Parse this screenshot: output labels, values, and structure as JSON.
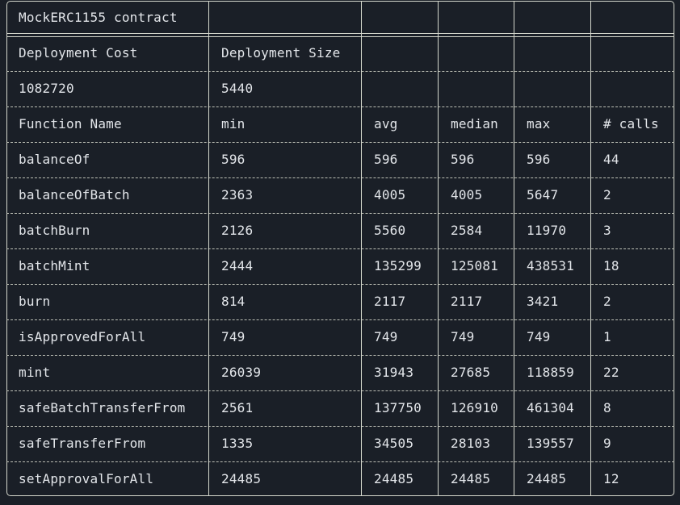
{
  "title": "MockERC1155 contract",
  "deployment": {
    "headers": [
      "Deployment Cost",
      "Deployment Size"
    ],
    "values": [
      "1082720",
      "5440"
    ]
  },
  "columns": [
    "Function Name",
    "min",
    "avg",
    "median",
    "max",
    "# calls"
  ],
  "rows": [
    [
      "balanceOf",
      "596",
      "596",
      "596",
      "596",
      "44"
    ],
    [
      "balanceOfBatch",
      "2363",
      "4005",
      "4005",
      "5647",
      "2"
    ],
    [
      "batchBurn",
      "2126",
      "5560",
      "2584",
      "11970",
      "3"
    ],
    [
      "batchMint",
      "2444",
      "135299",
      "125081",
      "438531",
      "18"
    ],
    [
      "burn",
      "814",
      "2117",
      "2117",
      "3421",
      "2"
    ],
    [
      "isApprovedForAll",
      "749",
      "749",
      "749",
      "749",
      "1"
    ],
    [
      "mint",
      "26039",
      "31943",
      "27685",
      "118859",
      "22"
    ],
    [
      "safeBatchTransferFrom",
      "2561",
      "137750",
      "126910",
      "461304",
      "8"
    ],
    [
      "safeTransferFrom",
      "1335",
      "34505",
      "28103",
      "139557",
      "9"
    ],
    [
      "setApprovalForAll",
      "24485",
      "24485",
      "24485",
      "24485",
      "12"
    ]
  ],
  "colors": {
    "background": "#1a1f27",
    "text": "#e3e6ea",
    "border": "#d4d7cc"
  }
}
